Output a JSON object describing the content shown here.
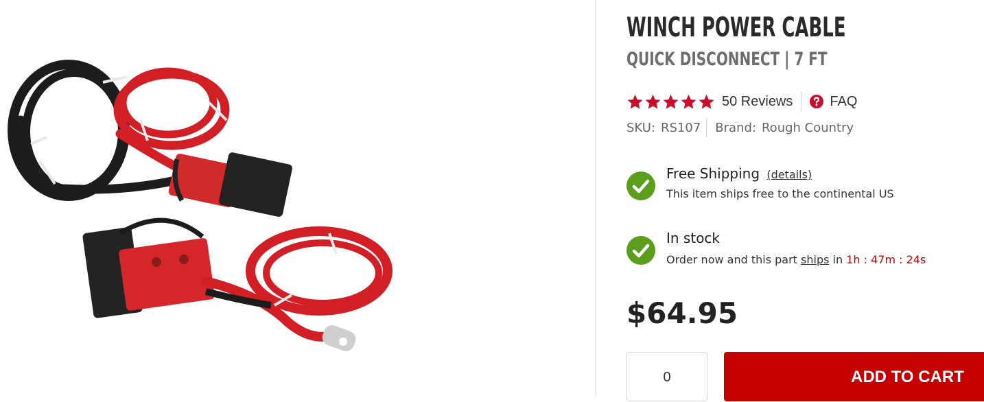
{
  "product": {
    "title": "WINCH POWER CABLE",
    "subtitle": "QUICK DISCONNECT | 7 FT",
    "rating": 5,
    "reviews_label": "50 Reviews",
    "faq_label": "FAQ",
    "sku_label": "SKU:",
    "sku_value": "RS107",
    "brand_label": "Brand:",
    "brand_value": "Rough Country",
    "price": "$64.95"
  },
  "shipping": {
    "title": "Free Shipping",
    "details_link": "(details)",
    "subtitle": "This item ships free to the continental US"
  },
  "stock": {
    "title": "In stock",
    "sub_before": "Order now and this part ",
    "sub_link": "ships",
    "sub_mid": " in ",
    "countdown": "1h : 47m : 24s"
  },
  "cart": {
    "quantity": "0",
    "add_label": "ADD TO CART"
  },
  "icons": {
    "star": "star-icon",
    "faq": "question-circle-icon",
    "check": "check-circle-icon"
  },
  "colors": {
    "accent_red": "#c50000",
    "star_red": "#c8102e",
    "check_green": "#5a9e1b",
    "countdown_red": "#c00000"
  }
}
